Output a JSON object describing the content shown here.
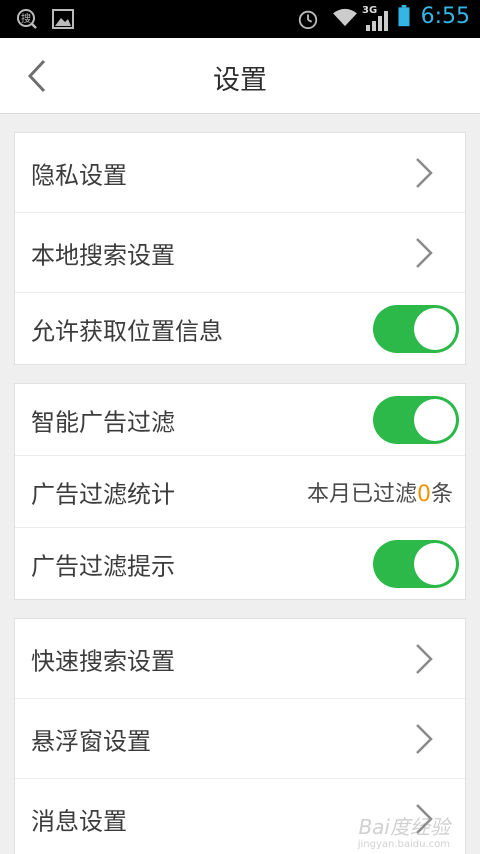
{
  "status_bar": {
    "time": "6:55",
    "network": "3G",
    "icons": [
      "search-app-icon",
      "image-icon",
      "alarm-icon",
      "wifi-icon",
      "signal-icon",
      "battery-icon"
    ],
    "time_color": "#33b5e5"
  },
  "header": {
    "title": "设置",
    "back_icon": "chevron-left-icon"
  },
  "groups": [
    {
      "rows": [
        {
          "label": "隐私设置",
          "control": "chevron"
        },
        {
          "label": "本地搜索设置",
          "control": "chevron"
        },
        {
          "label": "允许获取位置信息",
          "control": "toggle",
          "on": true
        }
      ]
    },
    {
      "rows": [
        {
          "label": "智能广告过滤",
          "control": "toggle",
          "on": true
        },
        {
          "label": "广告过滤统计",
          "control": "text",
          "value_prefix": "本月已过滤",
          "value_count": "0",
          "value_suffix": "条"
        },
        {
          "label": "广告过滤提示",
          "control": "toggle",
          "on": true
        }
      ]
    },
    {
      "rows": [
        {
          "label": "快速搜索设置",
          "control": "chevron"
        },
        {
          "label": "悬浮窗设置",
          "control": "chevron"
        },
        {
          "label": "消息设置",
          "control": "chevron"
        }
      ]
    }
  ],
  "colors": {
    "toggle_on": "#2db84a",
    "count_highlight": "#f39200",
    "background": "#efefef"
  },
  "watermark": {
    "text": "Bai度经验",
    "sub": "jingyan.baidu.com"
  }
}
